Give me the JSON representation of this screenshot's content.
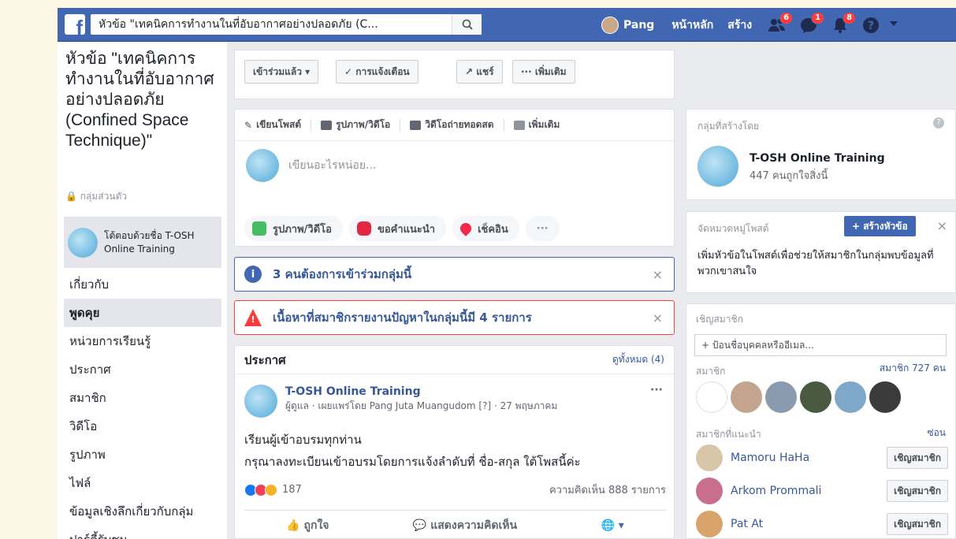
{
  "topbar": {
    "search_value": "หัวข้อ \"เทคนิคการทำงานในที่อับอากาศอย่างปลอดภัย (C...",
    "user_name": "Pang",
    "home": "หน้าหลัก",
    "create": "สร้าง",
    "friend_badge": "6",
    "message_badge": "1",
    "notif_badge": "8"
  },
  "group": {
    "title": "หัวข้อ \"เทคนิคการทำงานในที่อับอากาศอย่างปลอดภัย (Confined Space Technique)\"",
    "privacy": "กลุ่มส่วนตัว",
    "admin_line1": "โต้ตอบด้วยชื่อ T-OSH",
    "admin_line2": "Online Training"
  },
  "left_nav": [
    "เกี่ยวกับ",
    "พูดคุย",
    "หน่วยการเรียนรู้",
    "ประกาศ",
    "สมาชิก",
    "วิดีโอ",
    "รูปภาพ",
    "ไฟล์",
    "ข้อมูลเชิงลึกเกี่ยวกับกลุ่ม",
    "ปาร์ตี้รับชม"
  ],
  "action_bar": {
    "joined": "เข้าร่วมแล้ว ▾",
    "notifications": "✓ การแจ้งเตือน",
    "share": "↗ แชร์",
    "more": "··· เพิ่มเติม"
  },
  "composer": {
    "tab_write": "เขียนโพสต์",
    "tab_photo": "รูปภาพ/วิดีโอ",
    "tab_live": "วิดีโอถ่ายทอดสด",
    "tab_more": "เพิ่มเติม",
    "placeholder": "เขียนอะไรหน่อย...",
    "btn_photo": "รูปภาพ/วิดีโอ",
    "btn_reco": "ขอคำแนะนำ",
    "btn_checkin": "เช็คอิน",
    "btn_dots": "···"
  },
  "notices": {
    "join_requests": "3 คนต้องการเข้าร่วมกลุ่มนี้",
    "reported": "เนื้อหาที่สมาชิกรายงานปัญหาในกลุ่มนี้มี 4 รายการ"
  },
  "announcement": {
    "title": "ประกาศ",
    "see_all": "ดูทั้งหมด (4)",
    "author": "T-OSH Online Training",
    "meta": "ผู้ดูแล · เผยแพร่โดย Pang Juta Muangudom [?] · 27 พฤษภาคม",
    "line1": "เรียนผู้เข้าอบรมทุกท่าน",
    "line2": "กรุณาลงทะเบียนเข้าอบรมโดยการแจ้งลำดับที่ ชื่อ-สกุล ใต้โพสนี้ค่ะ",
    "reactions": "187",
    "comments": "ความคิดเห็น 888 รายการ",
    "like": "ถูกใจ",
    "comment": "แสดงความคิดเห็น"
  },
  "right": {
    "created_by": "กลุ่มที่สร้างโดย",
    "creator_name": "T-OSH Online Training",
    "creator_likes": "447 คนถูกใจสิ่งนี้",
    "topics_label": "จัดหมวดหมู่โพสต์",
    "create_topic": "+ สร้างหัวข้อ",
    "topics_desc": "เพิ่มหัวข้อในโพสต์เพื่อช่วยให้สมาชิกในกลุ่มพบข้อมูลที่พวกเขาสนใจ",
    "invite_label": "เชิญสมาชิก",
    "invite_placeholder": "+ ป้อนชื่อบุคคลหรืออีเมล...",
    "members_label": "สมาชิก",
    "members_count": "สมาชิก 727 คน",
    "suggested_label": "สมาชิกที่แนะนำ",
    "hide": "ซ่อน",
    "invite_btn": "เชิญสมาชิก",
    "suggested": [
      "Mamoru HaHa",
      "Arkom Prommali",
      "Pat At"
    ]
  }
}
